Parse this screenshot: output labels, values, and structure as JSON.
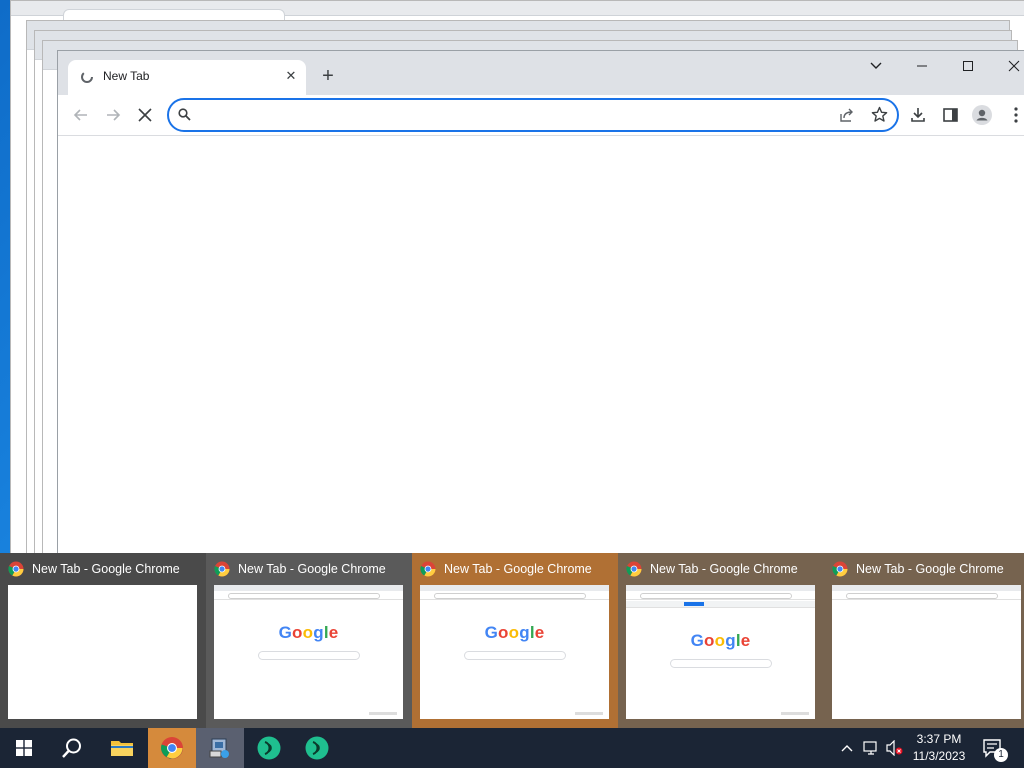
{
  "browser": {
    "tab_title": "New Tab",
    "omnibox_value": "",
    "omnibox_placeholder": ""
  },
  "thumbnails": [
    {
      "title": "New Tab - Google Chrome",
      "variant": "blank"
    },
    {
      "title": "New Tab - Google Chrome",
      "variant": "google"
    },
    {
      "title": "New Tab - Google Chrome",
      "variant": "google"
    },
    {
      "title": "New Tab - Google Chrome",
      "variant": "google-infobar"
    },
    {
      "title": "New Tab - Google Chrome",
      "variant": "blank-toolbar"
    }
  ],
  "google_logo": {
    "text": "Google",
    "colors": [
      "#4285f4",
      "#ea4335",
      "#fbbc05",
      "#4285f4",
      "#34a853",
      "#ea4335"
    ]
  },
  "clock": {
    "time": "3:37 PM",
    "date": "11/3/2023"
  },
  "notifications": {
    "count": "1"
  },
  "colors": {
    "accent": "#1a73e8",
    "taskbar": "#1b2535",
    "thumb_strip": "#7a6a57"
  }
}
